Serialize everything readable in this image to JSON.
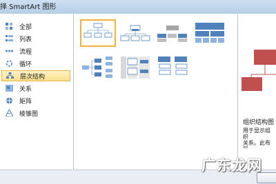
{
  "window": {
    "title": "择 SmartArt 图形"
  },
  "categories": [
    {
      "label": "全部",
      "icon": "all-icon"
    },
    {
      "label": "列表",
      "icon": "list-icon"
    },
    {
      "label": "流程",
      "icon": "process-icon"
    },
    {
      "label": "循环",
      "icon": "cycle-icon"
    },
    {
      "label": "层次结构",
      "icon": "hierarchy-icon",
      "selected": true
    },
    {
      "label": "关系",
      "icon": "relationship-icon"
    },
    {
      "label": "矩阵",
      "icon": "matrix-icon"
    },
    {
      "label": "棱锥图",
      "icon": "pyramid-icon"
    }
  ],
  "gallery": {
    "selected_index": 0,
    "items": [
      "org-chart",
      "name-title-org-chart",
      "half-circle-org-chart",
      "labeled-hierarchy",
      "horizontal-hierarchy",
      "table-hierarchy",
      "hierarchy-list",
      "lined-list"
    ]
  },
  "preview": {
    "title": "组织结构图",
    "description": "用于显示组织\n关系。此布局\n构图悬挂布局"
  },
  "watermark": "广东龙网",
  "colors": {
    "accent_selected": "#f2b135",
    "diagram_blue": "#4f81bd",
    "preview_red": "#c0504d"
  }
}
